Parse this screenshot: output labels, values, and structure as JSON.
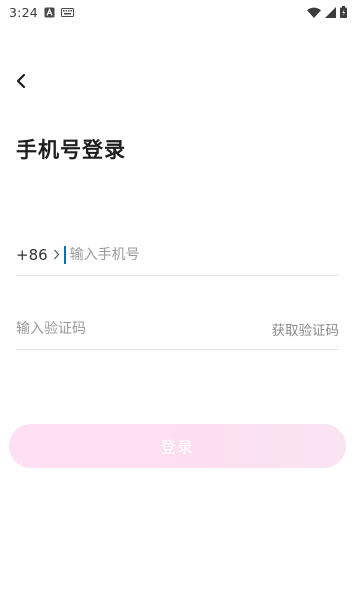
{
  "status_bar": {
    "time": "3:24",
    "icons_left": [
      "text-a-icon",
      "keyboard-icon"
    ],
    "icons_right": [
      "wifi-icon",
      "signal-icon",
      "battery-icon"
    ]
  },
  "header": {
    "back_icon": "chevron-left-icon",
    "title": "手机号登录"
  },
  "phone": {
    "country_code": "+86",
    "country_code_icon": "chevron-right-icon",
    "placeholder": "输入手机号",
    "value": ""
  },
  "verification": {
    "placeholder": "输入验证码",
    "value": "",
    "get_code_label": "获取验证码"
  },
  "login_button": {
    "label": "登录",
    "enabled": false,
    "gradient": [
      "#fde0f3",
      "#f9e4f2"
    ]
  },
  "colors": {
    "background": "#ffffff",
    "title": "#1e1e1e",
    "placeholder": "#9a9a9a",
    "divider": "#e4e4e4",
    "caret": "#1a6fa8"
  }
}
